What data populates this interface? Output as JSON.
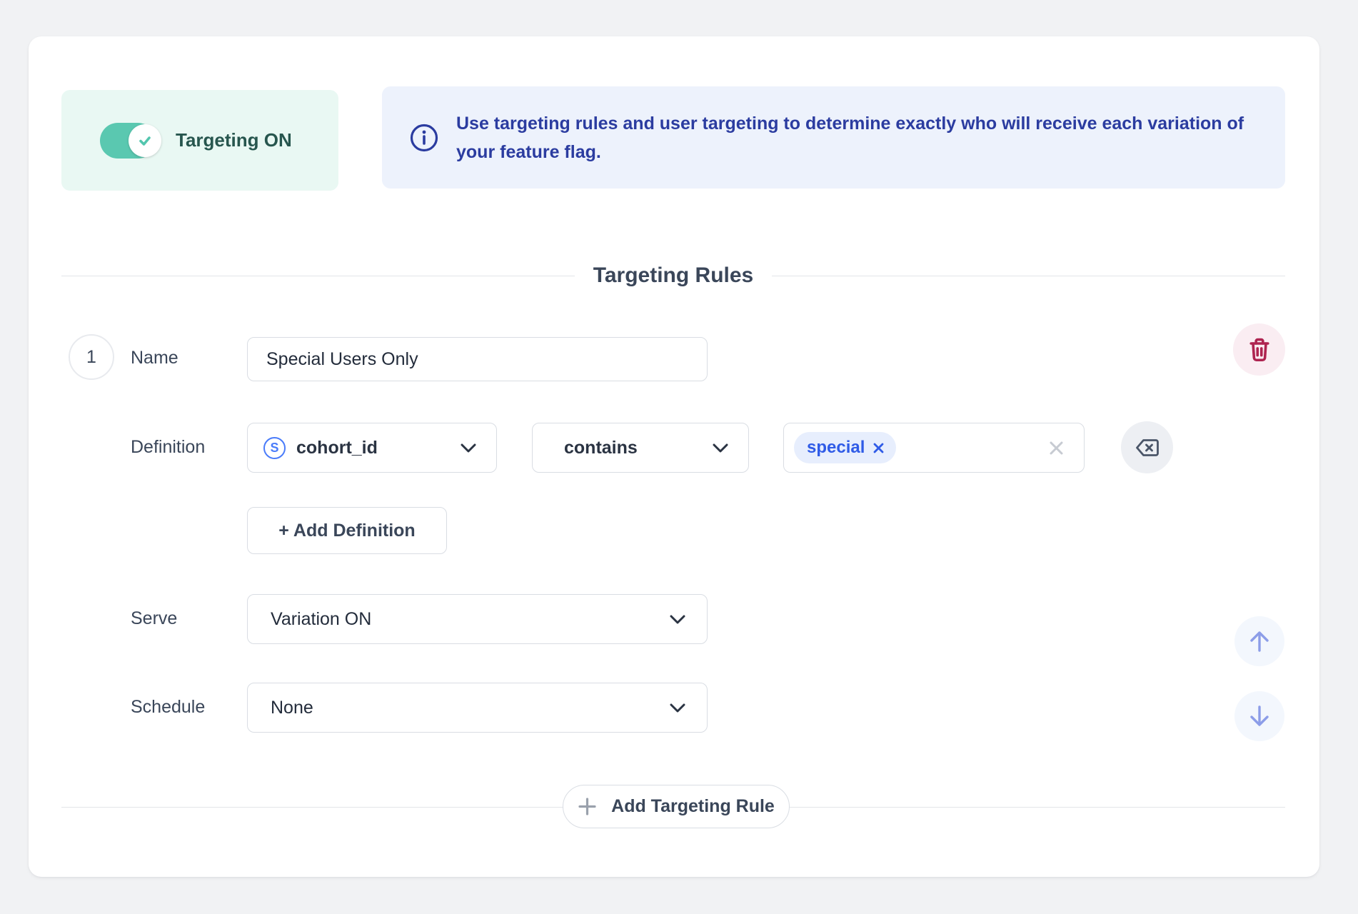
{
  "targeting_toggle": {
    "label": "Targeting ON",
    "state": "on"
  },
  "info_banner": {
    "text": "Use targeting rules and user targeting to determine exactly who will receive each variation of your feature flag."
  },
  "section": {
    "title": "Targeting Rules"
  },
  "rule": {
    "number": "1",
    "name_label": "Name",
    "name_value": "Special Users Only",
    "definition_label": "Definition",
    "attribute": {
      "glyph": "S",
      "value": "cohort_id"
    },
    "operator": "contains",
    "value_chips": [
      {
        "label": "special"
      }
    ],
    "add_definition_label": "+ Add Definition",
    "serve_label": "Serve",
    "serve_value": "Variation ON",
    "schedule_label": "Schedule",
    "schedule_value": "None"
  },
  "footer": {
    "add_rule_label": "Add Targeting Rule"
  },
  "colors": {
    "accent_teal": "#5AC8B0",
    "accent_blue": "#2F5BE7",
    "info_text": "#2B3CA0",
    "danger": "#AE2450",
    "mint_bg": "#E9F8F3",
    "banner_bg": "#EDF2FC"
  }
}
